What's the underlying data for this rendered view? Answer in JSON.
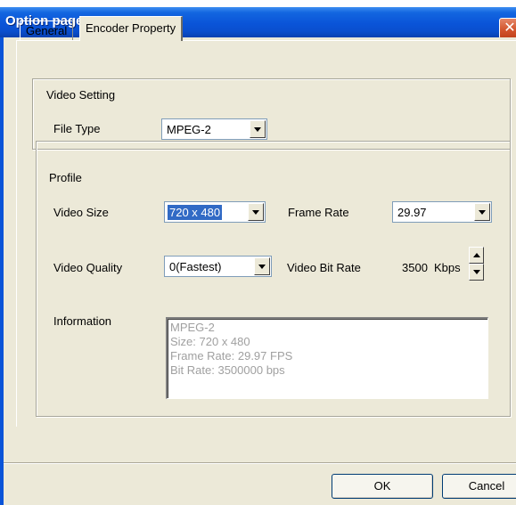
{
  "window": {
    "title": "Option page",
    "close_glyph": "✕"
  },
  "tabs": [
    {
      "label": "General",
      "active": false
    },
    {
      "label": "Encoder Property",
      "active": true
    }
  ],
  "video_setting": {
    "legend": "Video Setting",
    "file_type_label": "File Type",
    "file_type_value": "MPEG-2"
  },
  "profile": {
    "legend": "Profile",
    "video_size_label": "Video Size",
    "video_size_value": "720 x 480",
    "frame_rate_label": "Frame Rate",
    "frame_rate_value": "29.97",
    "video_quality_label": "Video Quality",
    "video_quality_value": "0(Fastest)",
    "video_bit_rate_label": "Video Bit Rate",
    "video_bit_rate_value": "3500",
    "video_bit_rate_unit": "Kbps",
    "information_label": "Information",
    "information_lines": [
      "MPEG-2",
      "Size: 720 x 480",
      "Frame Rate: 29.97 FPS",
      "Bit Rate: 3500000 bps"
    ]
  },
  "buttons": {
    "ok": "OK",
    "cancel": "Cancel"
  },
  "colors": {
    "titlebar": "#0a54d8",
    "dialog_bg": "#ece9d8",
    "selection": "#316ac5",
    "close_button": "#d2522a"
  }
}
